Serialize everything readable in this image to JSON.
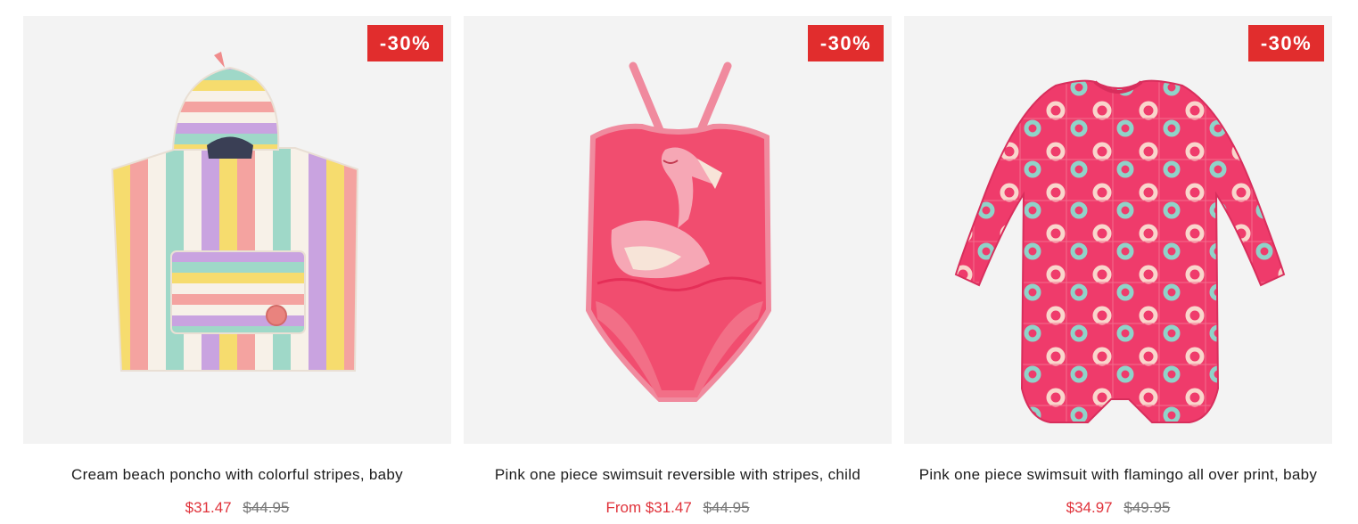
{
  "colors": {
    "sale": "#e0333b",
    "badge": "#e12d2d",
    "regular": "#777777",
    "card_bg": "#f3f3f3"
  },
  "products": [
    {
      "image": "striped-poncho",
      "badge": "-30%",
      "title": "Cream beach poncho with colorful stripes, baby",
      "price_sale": "$31.47",
      "price_regular": "$44.95"
    },
    {
      "image": "flamingo-swimsuit",
      "badge": "-30%",
      "title": "Pink one piece swimsuit reversible with stripes, child",
      "price_sale": "From $31.47",
      "price_regular": "$44.95"
    },
    {
      "image": "float-print-romper",
      "badge": "-30%",
      "title": "Pink one piece swimsuit with flamingo all over print, baby",
      "price_sale": "$34.97",
      "price_regular": "$49.95"
    }
  ]
}
